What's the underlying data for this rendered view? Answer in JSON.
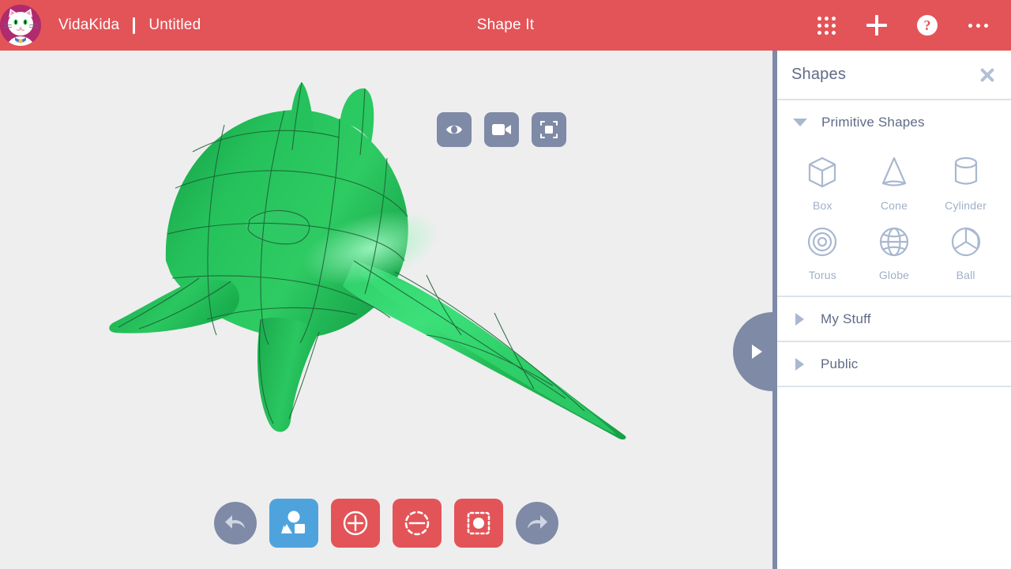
{
  "header": {
    "avatar_icon": "cat-avatar",
    "brand": "VidaKida",
    "document_title": "Untitled",
    "app_title": "Shape It",
    "actions": [
      {
        "id": "apps",
        "icon": "apps-grid-icon",
        "label": "Apps"
      },
      {
        "id": "add",
        "icon": "plus-icon",
        "label": "New"
      },
      {
        "id": "help",
        "icon": "help-circle-icon",
        "label": "Help"
      },
      {
        "id": "more",
        "icon": "ellipsis-icon",
        "label": "More"
      }
    ],
    "colors": {
      "background": "#e35458",
      "text": "#ffffff",
      "avatar_bg": "#b02a6e"
    }
  },
  "canvas": {
    "background": "#eeeeee",
    "model": {
      "name": "3d-model",
      "fill": "#22c05a",
      "shade_dark": "#13a045",
      "shade_light": "#3ee07a",
      "wireframe": "#1d5c32",
      "description": "Green organic 3D sculpt with spikes and a tapering tail"
    },
    "view_toolbar": [
      {
        "id": "view-mode",
        "icon": "eye-icon",
        "label": "View"
      },
      {
        "id": "record",
        "icon": "video-camera-icon",
        "label": "Record"
      },
      {
        "id": "fit-view",
        "icon": "fit-frame-icon",
        "label": "Fit to View"
      }
    ],
    "bottom_toolbar": [
      {
        "id": "undo",
        "icon": "undo-arrow-icon",
        "label": "Undo",
        "style": "round",
        "active": false
      },
      {
        "id": "shapes",
        "icon": "shapes-icon",
        "label": "Shapes",
        "style": "blue",
        "active": true
      },
      {
        "id": "add-shape",
        "icon": "circle-plus-icon",
        "label": "Add",
        "style": "red",
        "active": false
      },
      {
        "id": "subtract-shape",
        "icon": "dashed-circle-minus-icon",
        "label": "Subtract",
        "style": "red",
        "active": false
      },
      {
        "id": "group-shape",
        "icon": "dotted-square-circle-icon",
        "label": "Group",
        "style": "red",
        "active": false
      },
      {
        "id": "redo",
        "icon": "redo-arrow-icon",
        "label": "Redo",
        "style": "round",
        "active": false
      }
    ],
    "panel_handle_icon": "chevron-right-icon"
  },
  "panel": {
    "title": "Shapes",
    "close_icon": "close-icon",
    "sections": [
      {
        "id": "primitive-shapes",
        "label": "Primitive Shapes",
        "expanded": true
      },
      {
        "id": "my-stuff",
        "label": "My Stuff",
        "expanded": false
      },
      {
        "id": "public",
        "label": "Public",
        "expanded": false
      }
    ],
    "primitive_shapes": [
      {
        "id": "box",
        "label": "Box",
        "icon": "box-icon"
      },
      {
        "id": "cone",
        "label": "Cone",
        "icon": "cone-icon"
      },
      {
        "id": "cylinder",
        "label": "Cylinder",
        "icon": "cylinder-icon"
      },
      {
        "id": "torus",
        "label": "Torus",
        "icon": "torus-icon"
      },
      {
        "id": "globe",
        "label": "Globe",
        "icon": "globe-icon"
      },
      {
        "id": "ball",
        "label": "Ball",
        "icon": "ball-icon"
      }
    ],
    "colors": {
      "background": "#ffffff",
      "text": "#5f6b85",
      "icon": "#a9b8cf",
      "rule": "#dde3ec"
    }
  }
}
